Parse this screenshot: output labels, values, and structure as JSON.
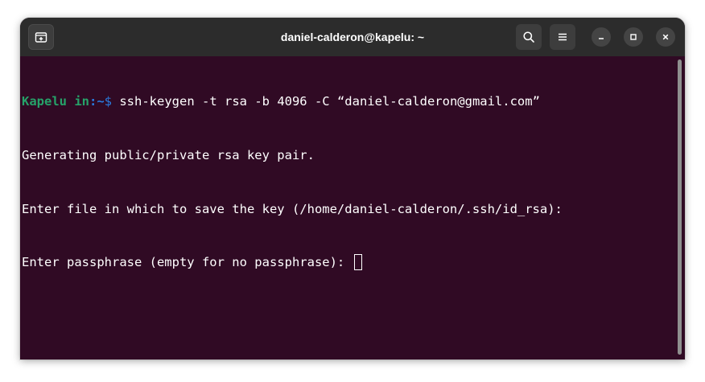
{
  "window": {
    "title": "daniel-calderon@kapelu: ~"
  },
  "titlebar": {
    "new_tab_icon": "new-tab-icon",
    "search_icon": "search-icon",
    "menu_icon": "hamburger-menu-icon",
    "minimize_icon": "minimize-icon",
    "maximize_icon": "maximize-icon",
    "close_icon": "close-icon"
  },
  "terminal": {
    "prompt": {
      "host": "Kapelu in",
      "path": ":~",
      "dollar": "$",
      "command": " ssh-keygen -t rsa -b 4096 -C “daniel-calderon@gmail.com”"
    },
    "output": [
      "Generating public/private rsa key pair.",
      "Enter file in which to save the key (/home/daniel-calderon/.ssh/id_rsa):",
      "Enter passphrase (empty for no passphrase): "
    ]
  },
  "colors": {
    "background": "#300a24",
    "titlebar": "#2c2c2c",
    "prompt_host": "#26a269",
    "prompt_path": "#2a7bde",
    "text": "#ffffff"
  }
}
